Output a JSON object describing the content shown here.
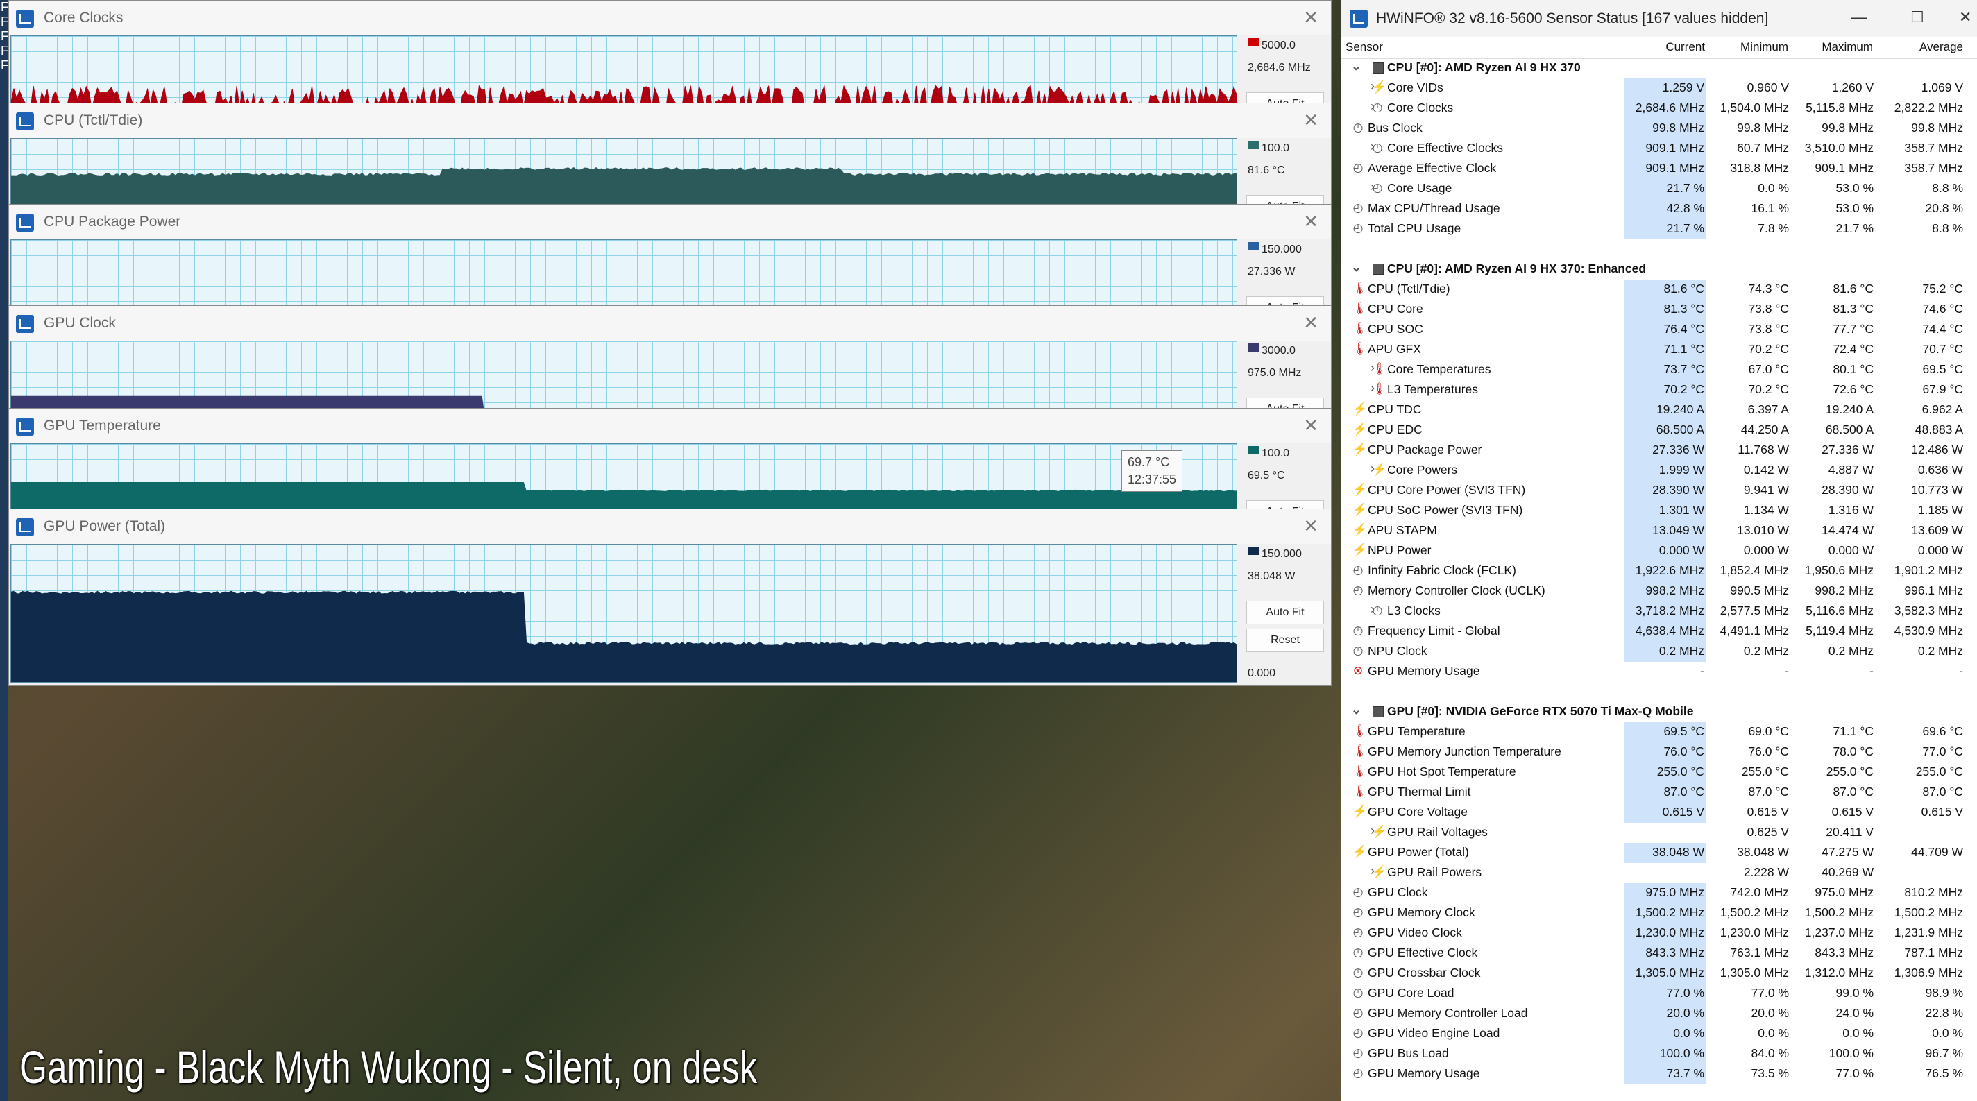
{
  "desktop_letters": [
    "F",
    "F",
    "F",
    "F",
    "F"
  ],
  "graphs": [
    {
      "title": "Core Clocks",
      "max": "5000.0",
      "current": "2,684.6 MHz",
      "min": "0.0",
      "color": "#b00010",
      "marker_color": "#d00000",
      "level": 0.54,
      "variance": 0.1,
      "shape": "noisy"
    },
    {
      "title": "CPU (Tctl/Tdie)",
      "max": "100.0",
      "current": "81.6 °C",
      "min": "0.0",
      "color": "#2c5a5a",
      "marker_color": "#2c6e6e",
      "level": 0.74,
      "variance": 0.02,
      "shape": "flat"
    },
    {
      "title": "CPU Package Power",
      "max": "150.000",
      "current": "27.336 W",
      "min": "0.000",
      "color": "#1a3a52",
      "marker_color": "#2a5fa0",
      "level": 0.08,
      "variance": 0.03,
      "shape": "lowspikes"
    },
    {
      "title": "GPU Clock",
      "max": "3000.0",
      "current": "975.0 MHz",
      "min": "0.0",
      "color": "#3a3a6e",
      "marker_color": "#3a3a6e",
      "level": 0.6,
      "variance": 0.02,
      "shape": "gpuclock"
    },
    {
      "title": "GPU Temperature",
      "max": "100.0",
      "current": "69.5 °C",
      "min": "0.0",
      "color": "#0d6a66",
      "marker_color": "#0d6a66",
      "level": 0.72,
      "variance": 0.01,
      "shape": "gputemp"
    },
    {
      "title": "GPU Power (Total)",
      "max": "150.000",
      "current": "38.048 W",
      "min": "0.000",
      "color": "#0f2a4a",
      "marker_color": "#0f2a4a",
      "level": 0.3,
      "variance": 0.02,
      "shape": "gpupower"
    }
  ],
  "buttons": {
    "autofit": "Auto Fit",
    "reset": "Reset"
  },
  "tooltip": {
    "value": "69.7 °C",
    "time": "12:37:55"
  },
  "caption": "Gaming - Black Myth Wukong - Silent, on desk",
  "hw": {
    "title": "HWiNFO® 32 v8.16-5600 Sensor Status [167 values hidden]",
    "columns": [
      "Sensor",
      "Current",
      "Minimum",
      "Maximum",
      "Average"
    ],
    "rows": [
      {
        "t": "group",
        "name": "CPU [#0]: AMD Ryzen AI 9 HX 370"
      },
      {
        "icon": "bolt",
        "indent": 1,
        "exp": true,
        "name": "Core VIDs",
        "v": [
          "1.259 V",
          "0.960 V",
          "1.260 V",
          "1.069 V"
        ]
      },
      {
        "icon": "clock",
        "indent": 1,
        "exp": true,
        "name": "Core Clocks",
        "v": [
          "2,684.6 MHz",
          "1,504.0 MHz",
          "5,115.8 MHz",
          "2,822.2 MHz"
        ]
      },
      {
        "icon": "clock",
        "indent": 0,
        "name": "Bus Clock",
        "v": [
          "99.8 MHz",
          "99.8 MHz",
          "99.8 MHz",
          "99.8 MHz"
        ]
      },
      {
        "icon": "clock",
        "indent": 1,
        "exp": true,
        "name": "Core Effective Clocks",
        "v": [
          "909.1 MHz",
          "60.7 MHz",
          "3,510.0 MHz",
          "358.7 MHz"
        ]
      },
      {
        "icon": "clock",
        "indent": 0,
        "name": "Average Effective Clock",
        "v": [
          "909.1 MHz",
          "318.8 MHz",
          "909.1 MHz",
          "358.7 MHz"
        ]
      },
      {
        "icon": "clock",
        "indent": 1,
        "exp": true,
        "name": "Core Usage",
        "v": [
          "21.7 %",
          "0.0 %",
          "53.0 %",
          "8.8 %"
        ]
      },
      {
        "icon": "clock",
        "indent": 0,
        "name": "Max CPU/Thread Usage",
        "v": [
          "42.8 %",
          "16.1 %",
          "53.0 %",
          "20.8 %"
        ]
      },
      {
        "icon": "clock",
        "indent": 0,
        "name": "Total CPU Usage",
        "v": [
          "21.7 %",
          "7.8 %",
          "21.7 %",
          "8.8 %"
        ]
      },
      {
        "t": "spacer"
      },
      {
        "t": "group",
        "name": "CPU [#0]: AMD Ryzen AI 9 HX 370: Enhanced"
      },
      {
        "icon": "temp",
        "indent": 0,
        "name": "CPU (Tctl/Tdie)",
        "v": [
          "81.6 °C",
          "74.3 °C",
          "81.6 °C",
          "75.2 °C"
        ]
      },
      {
        "icon": "temp",
        "indent": 0,
        "name": "CPU Core",
        "v": [
          "81.3 °C",
          "73.8 °C",
          "81.3 °C",
          "74.6 °C"
        ]
      },
      {
        "icon": "temp",
        "indent": 0,
        "name": "CPU SOC",
        "v": [
          "76.4 °C",
          "73.8 °C",
          "77.7 °C",
          "74.4 °C"
        ]
      },
      {
        "icon": "temp",
        "indent": 0,
        "name": "APU GFX",
        "v": [
          "71.1 °C",
          "70.2 °C",
          "72.4 °C",
          "70.7 °C"
        ]
      },
      {
        "icon": "temp",
        "indent": 1,
        "exp": true,
        "name": "Core Temperatures",
        "v": [
          "73.7 °C",
          "67.0 °C",
          "80.1 °C",
          "69.5 °C"
        ]
      },
      {
        "icon": "temp",
        "indent": 1,
        "exp": true,
        "name": "L3 Temperatures",
        "v": [
          "70.2 °C",
          "70.2 °C",
          "72.6 °C",
          "67.9 °C"
        ]
      },
      {
        "icon": "bolt",
        "indent": 0,
        "name": "CPU TDC",
        "v": [
          "19.240 A",
          "6.397 A",
          "19.240 A",
          "6.962 A"
        ]
      },
      {
        "icon": "bolt",
        "indent": 0,
        "name": "CPU EDC",
        "v": [
          "68.500 A",
          "44.250 A",
          "68.500 A",
          "48.883 A"
        ]
      },
      {
        "icon": "bolt",
        "indent": 0,
        "name": "CPU Package Power",
        "v": [
          "27.336 W",
          "11.768 W",
          "27.336 W",
          "12.486 W"
        ]
      },
      {
        "icon": "bolt",
        "indent": 1,
        "exp": true,
        "name": "Core Powers",
        "v": [
          "1.999 W",
          "0.142 W",
          "4.887 W",
          "0.636 W"
        ]
      },
      {
        "icon": "bolt",
        "indent": 0,
        "name": "CPU Core Power (SVI3 TFN)",
        "v": [
          "28.390 W",
          "9.941 W",
          "28.390 W",
          "10.773 W"
        ]
      },
      {
        "icon": "bolt",
        "indent": 0,
        "name": "CPU SoC Power (SVI3 TFN)",
        "v": [
          "1.301 W",
          "1.134 W",
          "1.316 W",
          "1.185 W"
        ]
      },
      {
        "icon": "bolt",
        "indent": 0,
        "name": "APU STAPM",
        "v": [
          "13.049 W",
          "13.010 W",
          "14.474 W",
          "13.609 W"
        ]
      },
      {
        "icon": "bolt",
        "indent": 0,
        "name": "NPU Power",
        "v": [
          "0.000 W",
          "0.000 W",
          "0.000 W",
          "0.000 W"
        ]
      },
      {
        "icon": "clock",
        "indent": 0,
        "name": "Infinity Fabric Clock (FCLK)",
        "v": [
          "1,922.6 MHz",
          "1,852.4 MHz",
          "1,950.6 MHz",
          "1,901.2 MHz"
        ]
      },
      {
        "icon": "clock",
        "indent": 0,
        "name": "Memory Controller Clock (UCLK)",
        "v": [
          "998.2 MHz",
          "990.5 MHz",
          "998.2 MHz",
          "996.1 MHz"
        ]
      },
      {
        "icon": "clock",
        "indent": 1,
        "exp": true,
        "name": "L3 Clocks",
        "v": [
          "3,718.2 MHz",
          "2,577.5 MHz",
          "5,116.6 MHz",
          "3,582.3 MHz"
        ]
      },
      {
        "icon": "clock",
        "indent": 0,
        "name": "Frequency Limit - Global",
        "v": [
          "4,638.4 MHz",
          "4,491.1 MHz",
          "5,119.4 MHz",
          "4,530.9 MHz"
        ]
      },
      {
        "icon": "clock",
        "indent": 0,
        "name": "NPU Clock",
        "v": [
          "0.2 MHz",
          "0.2 MHz",
          "0.2 MHz",
          "0.2 MHz"
        ]
      },
      {
        "icon": "error",
        "indent": 0,
        "name": "GPU Memory Usage",
        "v": [
          "-",
          "-",
          "-",
          "-"
        ],
        "nobg": true
      },
      {
        "t": "spacer"
      },
      {
        "t": "group",
        "name": "GPU [#0]: NVIDIA  GeForce RTX 5070 Ti Max-Q Mobile"
      },
      {
        "icon": "temp",
        "indent": 0,
        "name": "GPU Temperature",
        "v": [
          "69.5 °C",
          "69.0 °C",
          "71.1 °C",
          "69.6 °C"
        ]
      },
      {
        "icon": "temp",
        "indent": 0,
        "name": "GPU Memory Junction Temperature",
        "v": [
          "76.0 °C",
          "76.0 °C",
          "78.0 °C",
          "77.0 °C"
        ]
      },
      {
        "icon": "temp",
        "indent": 0,
        "name": "GPU Hot Spot Temperature",
        "v": [
          "255.0 °C",
          "255.0 °C",
          "255.0 °C",
          "255.0 °C"
        ]
      },
      {
        "icon": "temp",
        "indent": 0,
        "name": "GPU Thermal Limit",
        "v": [
          "87.0 °C",
          "87.0 °C",
          "87.0 °C",
          "87.0 °C"
        ]
      },
      {
        "icon": "bolt",
        "indent": 0,
        "name": "GPU Core Voltage",
        "v": [
          "0.615 V",
          "0.615 V",
          "0.615 V",
          "0.615 V"
        ]
      },
      {
        "icon": "bolt",
        "indent": 1,
        "exp": true,
        "name": "GPU Rail Voltages",
        "v": [
          "",
          "0.625 V",
          "20.411 V",
          ""
        ],
        "nobg": true
      },
      {
        "icon": "bolt",
        "indent": 0,
        "name": "GPU Power (Total)",
        "v": [
          "38.048 W",
          "38.048 W",
          "47.275 W",
          "44.709 W"
        ]
      },
      {
        "icon": "bolt",
        "indent": 1,
        "exp": true,
        "name": "GPU Rail Powers",
        "v": [
          "",
          "2.228 W",
          "40.269 W",
          ""
        ],
        "nobg": true
      },
      {
        "icon": "clock",
        "indent": 0,
        "name": "GPU Clock",
        "v": [
          "975.0 MHz",
          "742.0 MHz",
          "975.0 MHz",
          "810.2 MHz"
        ]
      },
      {
        "icon": "clock",
        "indent": 0,
        "name": "GPU Memory Clock",
        "v": [
          "1,500.2 MHz",
          "1,500.2 MHz",
          "1,500.2 MHz",
          "1,500.2 MHz"
        ]
      },
      {
        "icon": "clock",
        "indent": 0,
        "name": "GPU Video Clock",
        "v": [
          "1,230.0 MHz",
          "1,230.0 MHz",
          "1,237.0 MHz",
          "1,231.9 MHz"
        ]
      },
      {
        "icon": "clock",
        "indent": 0,
        "name": "GPU Effective Clock",
        "v": [
          "843.3 MHz",
          "763.1 MHz",
          "843.3 MHz",
          "787.1 MHz"
        ]
      },
      {
        "icon": "clock",
        "indent": 0,
        "name": "GPU Crossbar Clock",
        "v": [
          "1,305.0 MHz",
          "1,305.0 MHz",
          "1,312.0 MHz",
          "1,306.9 MHz"
        ]
      },
      {
        "icon": "clock",
        "indent": 0,
        "name": "GPU Core Load",
        "v": [
          "77.0 %",
          "77.0 %",
          "99.0 %",
          "98.9 %"
        ]
      },
      {
        "icon": "clock",
        "indent": 0,
        "name": "GPU Memory Controller Load",
        "v": [
          "20.0 %",
          "20.0 %",
          "24.0 %",
          "22.8 %"
        ]
      },
      {
        "icon": "clock",
        "indent": 0,
        "name": "GPU Video Engine Load",
        "v": [
          "0.0 %",
          "0.0 %",
          "0.0 %",
          "0.0 %"
        ]
      },
      {
        "icon": "clock",
        "indent": 0,
        "name": "GPU Bus Load",
        "v": [
          "100.0 %",
          "84.0 %",
          "100.0 %",
          "96.7 %"
        ]
      },
      {
        "icon": "clock",
        "indent": 0,
        "name": "GPU Memory Usage",
        "v": [
          "73.7 %",
          "73.5 %",
          "77.0 %",
          "76.5 %"
        ]
      }
    ]
  }
}
